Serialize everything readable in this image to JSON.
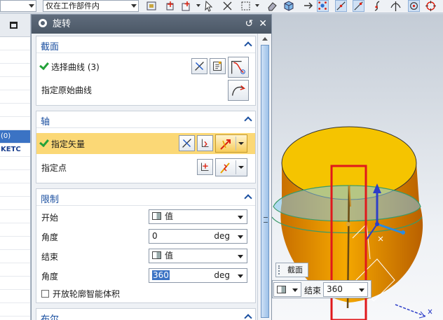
{
  "toolbar": {
    "filter_value": "",
    "scope_value": "仅在工作部件内"
  },
  "navigator": {
    "rows": [
      "",
      "",
      "",
      "",
      "",
      "",
      "",
      "(0)",
      "KETC",
      "",
      "",
      "",
      "",
      "",
      "",
      "",
      "",
      "",
      "",
      "",
      ""
    ]
  },
  "dialog": {
    "title": "旋转",
    "reset_icon": "↺",
    "close_icon": "✕",
    "sections": {
      "section": {
        "title": "截面",
        "select_curve": "选择曲线 (3)",
        "origin_curve": "指定原始曲线"
      },
      "axis": {
        "title": "轴",
        "specify_vector": "指定矢量",
        "specify_point": "指定点"
      },
      "limits": {
        "title": "限制",
        "start_label": "开始",
        "start_type": "值",
        "start_angle_label": "角度",
        "start_angle": "0",
        "start_unit": "deg",
        "end_label": "结束",
        "end_type": "值",
        "end_angle_label": "角度",
        "end_angle": "360",
        "end_unit": "deg",
        "open_profile": "开放轮廓智能体积"
      },
      "boolean": {
        "title": "布尔"
      }
    }
  },
  "viewport": {
    "section_label": "截面",
    "end_label": "结束",
    "end_value": "360",
    "colors": {
      "body_top": "#f5c400",
      "body_side": "#f0a000",
      "ring": "#7fc8f0",
      "highlight_box": "#e0181c"
    }
  }
}
